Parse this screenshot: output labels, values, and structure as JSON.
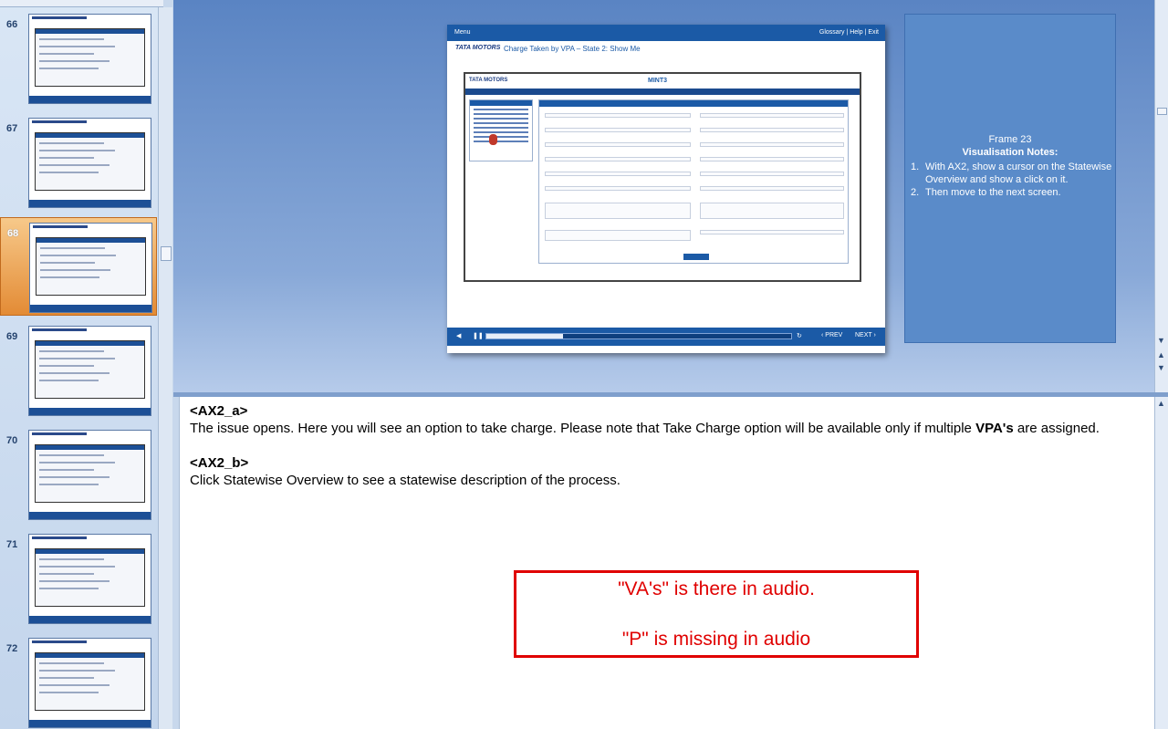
{
  "thumbnails": [
    {
      "number": "66",
      "selected": false
    },
    {
      "number": "67",
      "selected": false
    },
    {
      "number": "68",
      "selected": true
    },
    {
      "number": "69",
      "selected": false
    },
    {
      "number": "70",
      "selected": false
    },
    {
      "number": "71",
      "selected": false
    },
    {
      "number": "72",
      "selected": false
    }
  ],
  "player": {
    "menu_label": "Menu",
    "header_links": "Glossary | Help | Exit",
    "brand": "TATA MOTORS",
    "title": "Charge Taken by VPA – State 2: Show Me",
    "app_brand": "TATA MOTORS",
    "app_name": "MINT3",
    "prev_label": "‹ PREV",
    "next_label": "NEXT ›",
    "progress_fraction": 0.25
  },
  "frame_notes": {
    "frame": "Frame 23",
    "heading": "Visualisation Notes:",
    "items": [
      {
        "num": "1.",
        "text": "With AX2, show a cursor on the Statewise Overview and show a click on it."
      },
      {
        "num": "2.",
        "text": "Then move to the next screen."
      }
    ]
  },
  "speaker_notes": {
    "tag_a": "<AX2_a>",
    "para_a_1": "The issue opens. Here you will see an option to take charge. Please note that Take Charge option will be available only if multiple ",
    "para_a_bold": "VPA's",
    "para_a_2": " are assigned.",
    "tag_b": "<AX2_b>",
    "para_b": "Click Statewise Overview to see a statewise description of the process."
  },
  "review_comment": {
    "line1": "\"VA's\" is there in audio.",
    "line2": "\"P\" is missing in audio"
  },
  "colors": {
    "accent": "#1b5aa6",
    "selected_thumb": "#e38b35",
    "comment_red": "#e00000"
  }
}
